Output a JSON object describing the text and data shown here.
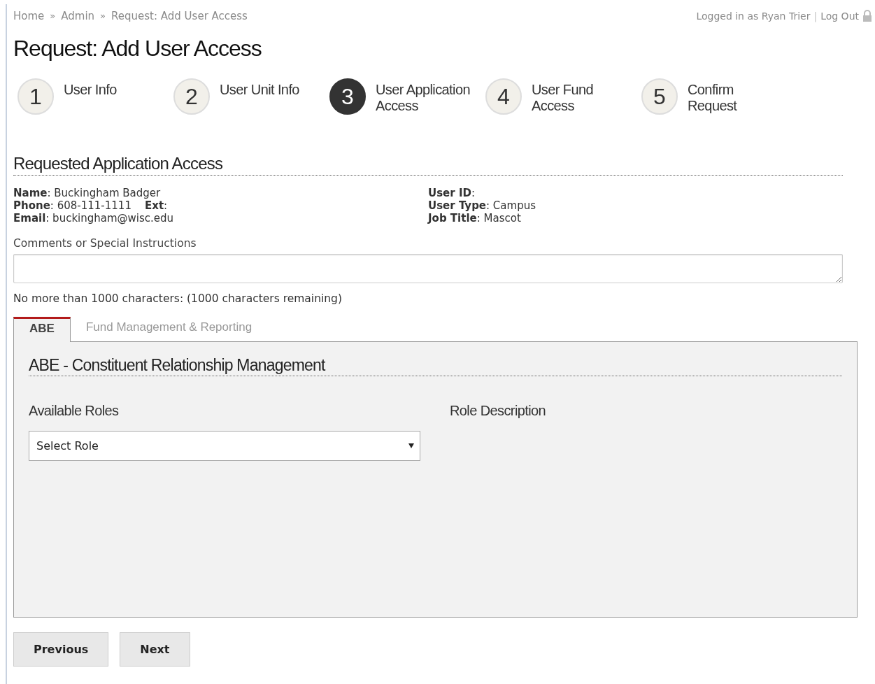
{
  "breadcrumb": [
    "Home",
    "Admin",
    "Request: Add User Access"
  ],
  "breadcrumb_separator": "»",
  "login": {
    "text": "Logged in as Ryan Trier",
    "separator": "|",
    "logout": "Log Out"
  },
  "title": "Request: Add User Access",
  "steps": [
    {
      "number": "1",
      "label": "User Info",
      "selected": false
    },
    {
      "number": "2",
      "label": "User Unit Info",
      "selected": false
    },
    {
      "number": "3",
      "label": "User Application Access",
      "selected": true
    },
    {
      "number": "4",
      "label": "User Fund Access",
      "selected": false
    },
    {
      "number": "5",
      "label": "Confirm Request",
      "selected": false
    }
  ],
  "section_title": "Requested Application Access",
  "user_details": {
    "left": [
      "**Name**: Buckingham Badger",
      "**Phone**: 608-111-1111    **Ext**:",
      "**Email**: buckingham@wisc.edu"
    ],
    "right": [
      "**User ID**:",
      "**User Type**: Campus",
      "**Job Title**: Mascot"
    ]
  },
  "comments": {
    "label": "Comments or Special Instructions",
    "hint": "No more than 1000 characters: (1000 characters remaining)"
  },
  "tabs": [
    {
      "label": "ABE",
      "selected": true
    },
    {
      "label": "Fund Management & Reporting",
      "selected": false
    }
  ],
  "panel": {
    "title": "ABE - Constituent Relationship Management",
    "roles_label": "Available Roles",
    "role_select": "Select Role",
    "description_label": "Role Description"
  },
  "buttons": [
    "Previous",
    "Next"
  ]
}
